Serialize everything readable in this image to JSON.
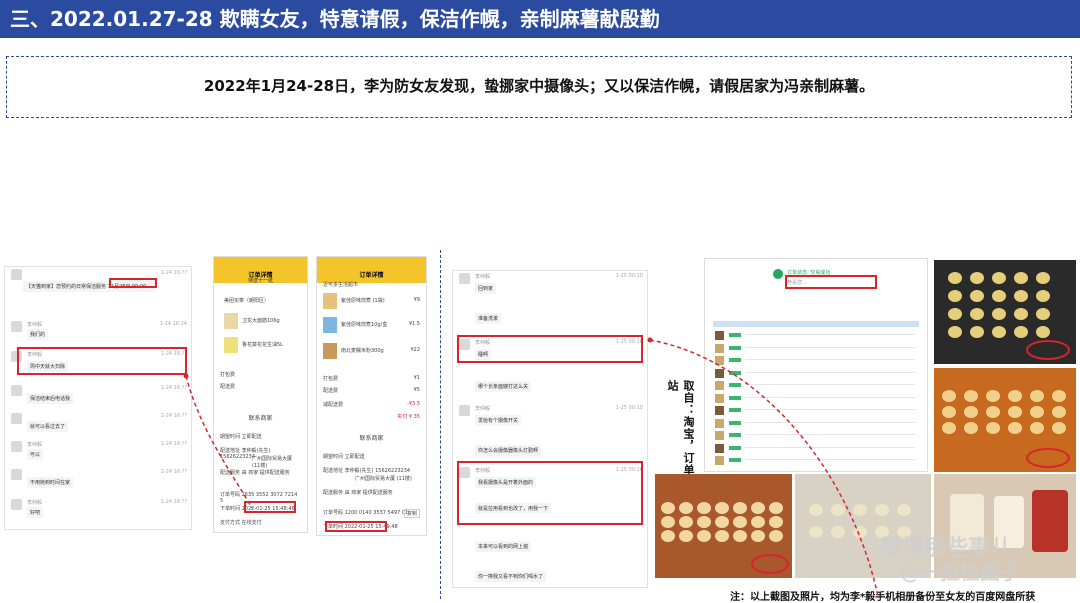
{
  "title": "三、2022.01.27-28  欺瞒女友，特意请假，保洁作幌，亲制麻薯献殷勤",
  "summary": "2022年1月24-28日，李为防女友发现，蛰挪家中摄像头；又以保洁作幌，请假居家为冯亲制麻薯。",
  "chat1": {
    "messages": [
      {
        "name": "",
        "time": "1-24 16:??",
        "text": "【天猫到家】您预约的日常保洁服务 11月28日 09:00 ..."
      },
      {
        "name": "李仲毅",
        "time": "1-24 16:24",
        "text": "我们的"
      },
      {
        "name": "李仲毅",
        "time": "1-24 16:??",
        "text": "周中天就大扫除"
      },
      {
        "name": "",
        "time": "1-24 16:??",
        "text": "保洁结束后电话我"
      },
      {
        "name": "",
        "time": "1-24 16:??",
        "text": "就可以看过去了"
      },
      {
        "name": "李仲毅",
        "time": "1-24 16:??",
        "text": "可以"
      },
      {
        "name": "",
        "time": "1-24 16:??",
        "text": "不用她到时间在家"
      },
      {
        "name": "李仲毅",
        "time": "1-24 16:??",
        "text": "好吧"
      }
    ],
    "highlight": "11月28日 09:00"
  },
  "phone1": {
    "nav_title": "订单详情",
    "status": "待送十一纸",
    "shop": "美团买菜（朝阳区）",
    "items": [
      "卫龙大面筋106g",
      "鲁花葵花花生油5L"
    ],
    "rows": [
      "打包费",
      "配送费"
    ],
    "contact": "联系商家",
    "fields": [
      {
        "label": "期望时间",
        "value": "立即配送"
      },
      {
        "label": "配送地址",
        "value": "李仲毅(先生) 15626223234"
      },
      {
        "label": "",
        "value": "广州国际贸易大厦 (11楼)"
      },
      {
        "label": "配送服务",
        "value": "由 商家 提供配送服务"
      },
      {
        "label": "订单号码",
        "value": "2635 3552 3072 7214 5"
      },
      {
        "label": "下单时间",
        "value": "2022-01-25 15:48:46"
      },
      {
        "label": "支付方式",
        "value": "在线支付"
      }
    ],
    "highlight": "2022-01-25 15:48:46"
  },
  "phone2": {
    "nav_title": "订单详情",
    "shop": "近可多生活超市",
    "items": [
      {
        "name": "紫佳原味煎煮 (1袋)",
        "price": "¥9"
      },
      {
        "name": "紫佳原味煎煮10g/盒",
        "price": "¥1.5"
      },
      {
        "name": "南北麦糯米粉300g",
        "price": "¥22"
      }
    ],
    "rows": [
      {
        "label": "打包费",
        "value": "¥1"
      },
      {
        "label": "配送费",
        "value": "¥5"
      },
      {
        "label": "减配送费",
        "value": "-¥3.5"
      }
    ],
    "total": "实付 ¥ 35",
    "contact": "联系商家",
    "fields": [
      {
        "label": "期望时间",
        "value": "立即配送"
      },
      {
        "label": "配送地址",
        "value": "李仲毅(先生) 15626223234"
      },
      {
        "label": "",
        "value": "广州国际贸易大厦 (11楼)"
      },
      {
        "label": "配送服务",
        "value": "由 商家 提供配送服务"
      },
      {
        "label": "订单号码",
        "value": "1200 0140 3537 5497 01"
      },
      {
        "label": "下单时间",
        "value": "2022-01-25 15:49:48"
      }
    ],
    "copy": "复制",
    "highlight": "2022-01-25 15:49:48"
  },
  "chat2": {
    "messages": [
      {
        "name": "李仲毅",
        "time": "1-25 00:10",
        "text": "回到家"
      },
      {
        "name": "",
        "time": "",
        "text": "准备洗漱"
      },
      {
        "name": "李仲毅",
        "time": "1-25 00:10",
        "text": "睡啊"
      },
      {
        "name": "",
        "time": "",
        "text": "哪个长条面嫂打这么关"
      },
      {
        "name": "李仲毅",
        "time": "1-25 00:10",
        "text": "发给有个摄像开关"
      },
      {
        "name": "",
        "time": "",
        "text": "你怎么会摄像器像头灯勤啊"
      },
      {
        "name": "李仲毅",
        "time": "1-25 00:10",
        "text": "我看摄像头是开着外面的"
      },
      {
        "name": "",
        "time": "",
        "text": "就是拉用看到也改了，用我一下"
      },
      {
        "name": "",
        "time": "",
        "text": "本来可以看到的网上遍"
      },
      {
        "name": "",
        "time": "",
        "text": "你一擦我又看不到你们喝水了"
      }
    ]
  },
  "side_note": "取自：淘宝，订单回收站",
  "order_screenshot": {
    "status": "订单状态: 交易成功",
    "note": "恭喜您..."
  },
  "watermark_line1": "微博那些事儿",
  "watermark_line2": "@一担桂圆子",
  "footnote": "注：以上截图及照片，均为李*毅手机相册备份至女友的百度网盘所获"
}
